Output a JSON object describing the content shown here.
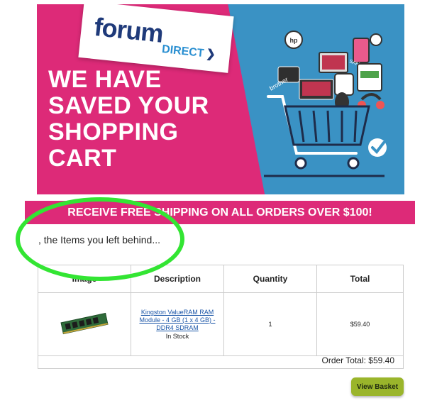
{
  "banner": {
    "logo_main": "forum",
    "logo_sub": "DIRECT",
    "headline": [
      "WE HAVE",
      "SAVED YOUR",
      "SHOPPING",
      "CART"
    ],
    "brand_marks": [
      "hp",
      "SAMSUNG",
      "brother"
    ],
    "colors": {
      "pink": "#dd2a78",
      "blue": "#3a92c4"
    }
  },
  "shipping_bar": {
    "text": "RECEIVE FREE SHIPPING ON ALL ORDERS OVER $100!"
  },
  "intro": {
    "text": ", the Items you left behind..."
  },
  "cart_table": {
    "headers": {
      "image": "Image",
      "description": "Description",
      "quantity": "Quantity",
      "total": "Total"
    },
    "items": [
      {
        "image_icon": "ram-module-image",
        "description": "Kingston ValueRAM RAM Module - 4 GB (1 x 4 GB) - DDR4 SDRAM",
        "stock": "In Stock",
        "quantity": "1",
        "total": "$59.40"
      }
    ],
    "order_total": "Order Total: $59.40"
  },
  "actions": {
    "view_basket": "View Basket"
  }
}
